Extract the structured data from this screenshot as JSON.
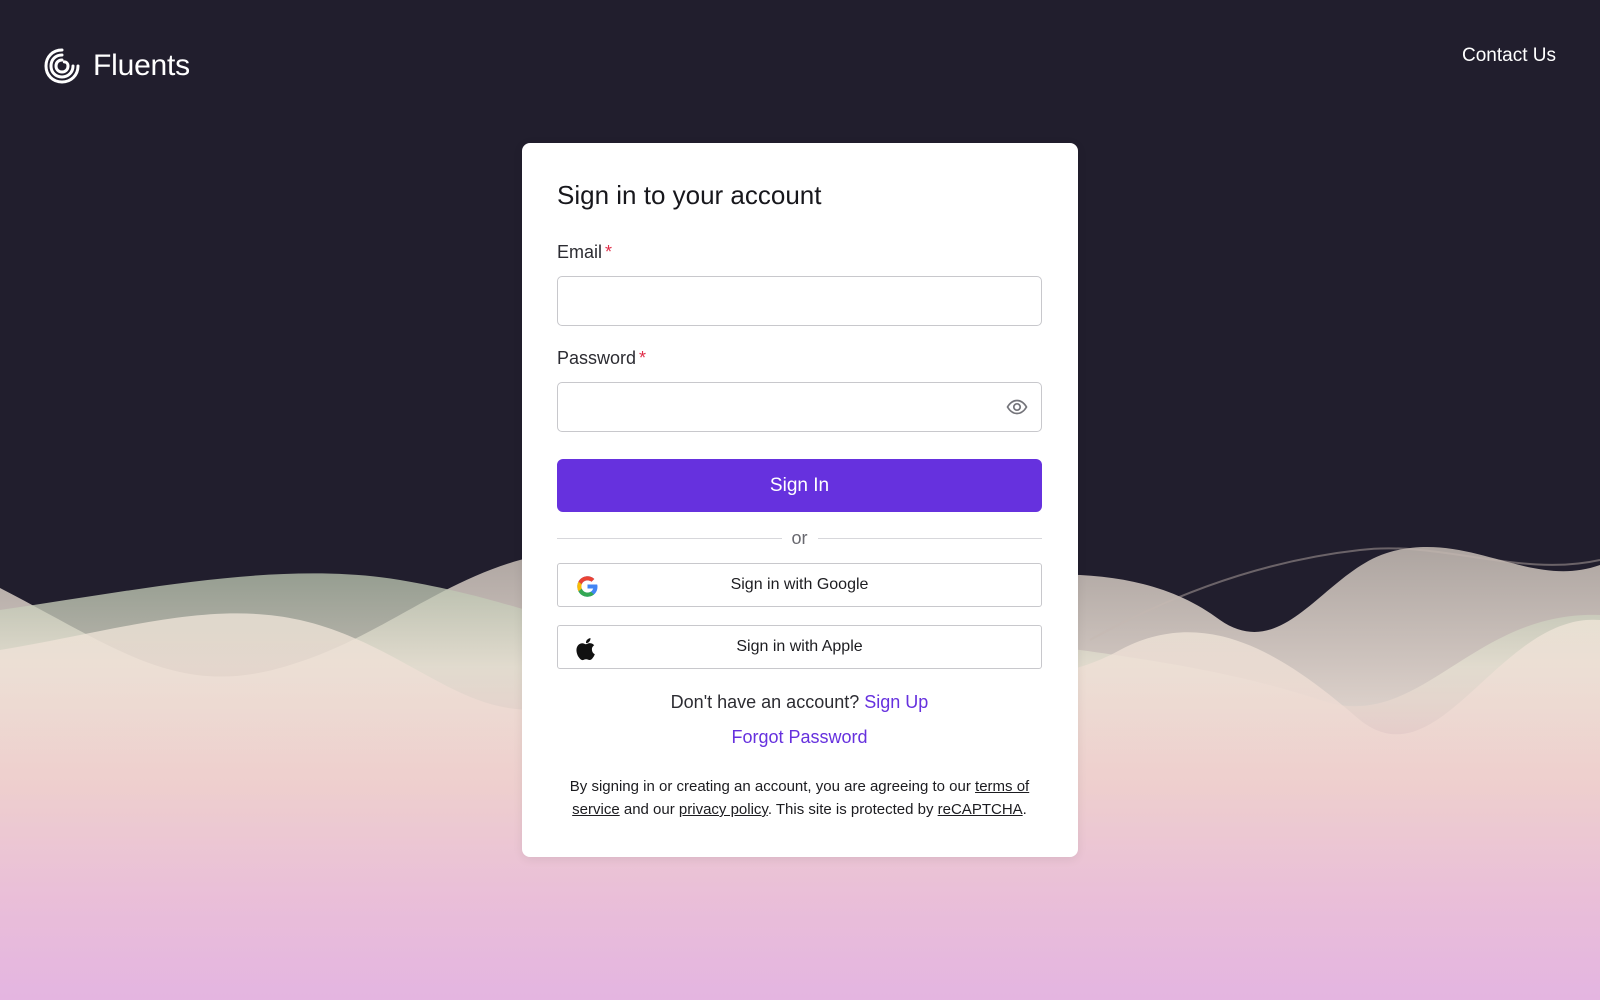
{
  "brand": {
    "name": "Fluents",
    "logo_icon": "spiral-logo-icon"
  },
  "header": {
    "contact_label": "Contact Us"
  },
  "form": {
    "title": "Sign in to your account",
    "email": {
      "label": "Email",
      "required_mark": "*",
      "value": "",
      "placeholder": ""
    },
    "password": {
      "label": "Password",
      "required_mark": "*",
      "value": "",
      "placeholder": "",
      "visibility_icon": "eye-icon"
    },
    "submit_label": "Sign In",
    "divider_text": "or",
    "social": {
      "google_label": "Sign in with Google",
      "google_icon": "google-icon",
      "apple_label": "Sign in with Apple",
      "apple_icon": "apple-icon"
    },
    "signup_prompt": "Don't have an account?",
    "signup_link": "Sign Up",
    "forgot_password": "Forgot Password",
    "legal": {
      "prefix": "By signing in or creating an account, you are agreeing to our ",
      "terms_link": "terms of service",
      "middle": " and our ",
      "privacy_link": "privacy policy",
      "suffix": ". This site is protected by ",
      "recaptcha_link": "reCAPTCHA",
      "end": "."
    }
  },
  "colors": {
    "background": "#211e2d",
    "accent": "#6631de",
    "required": "#e02e49",
    "card": "#ffffff"
  }
}
